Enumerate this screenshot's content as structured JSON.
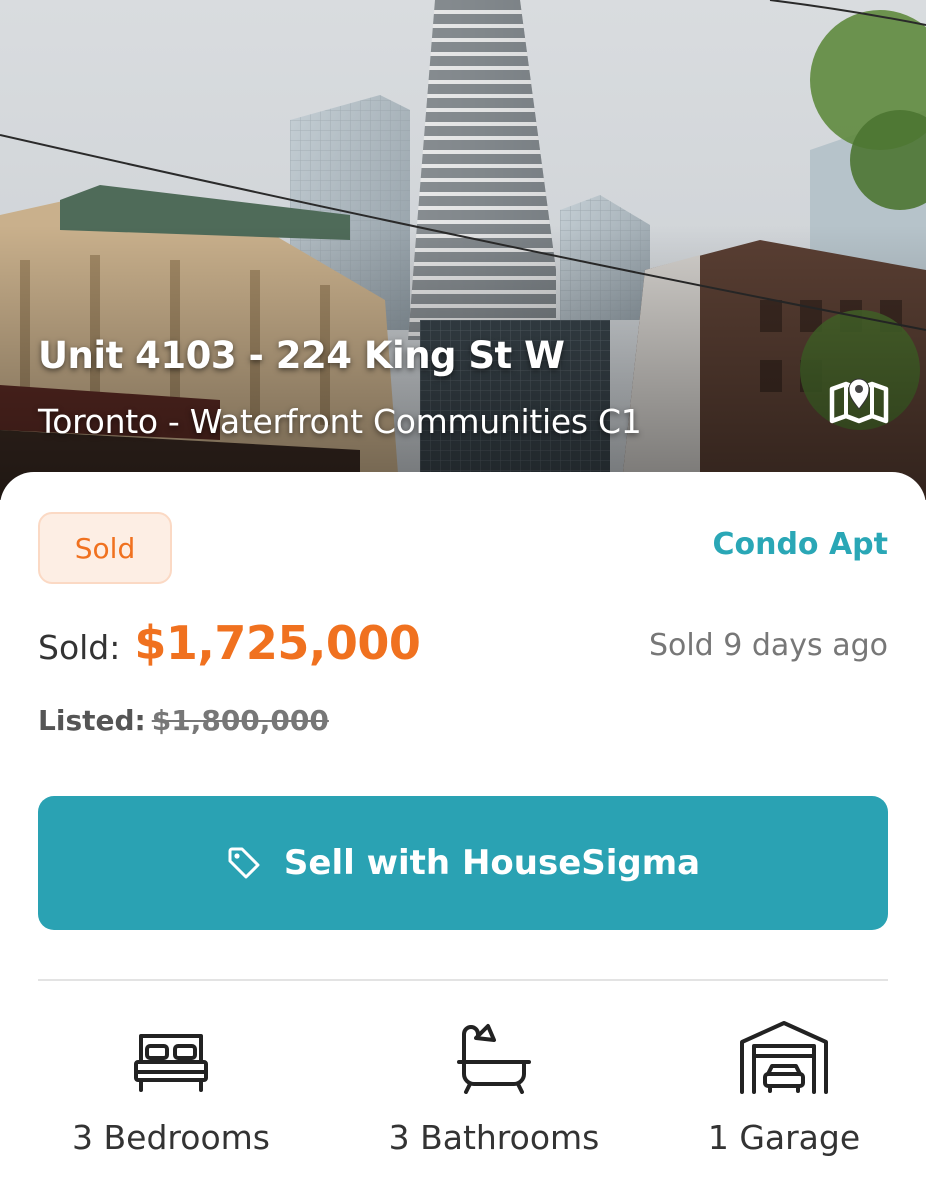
{
  "listing": {
    "title": "Unit 4103 - 224 King St W",
    "subtitle": "Toronto - Waterfront Communities C1",
    "status": "Sold",
    "property_type": "Condo Apt",
    "price_label": "Sold:",
    "sold_price": "$1,725,000",
    "sold_ago": "Sold 9 days ago",
    "listed_label": "Listed:",
    "listed_price": "$1,800,000"
  },
  "actions": {
    "sell_label": "Sell with HouseSigma"
  },
  "features": {
    "bedrooms": "3 Bedrooms",
    "bathrooms": "3 Bathrooms",
    "garage": "1 Garage"
  },
  "icons": {
    "map": "map-pin-icon",
    "tag": "tag-icon",
    "bed": "bed-icon",
    "bath": "bathtub-icon",
    "garage": "garage-icon"
  },
  "colors": {
    "accent": "#2aa2b3",
    "sold": "#f0711f",
    "badge_bg": "#fdeee4"
  }
}
